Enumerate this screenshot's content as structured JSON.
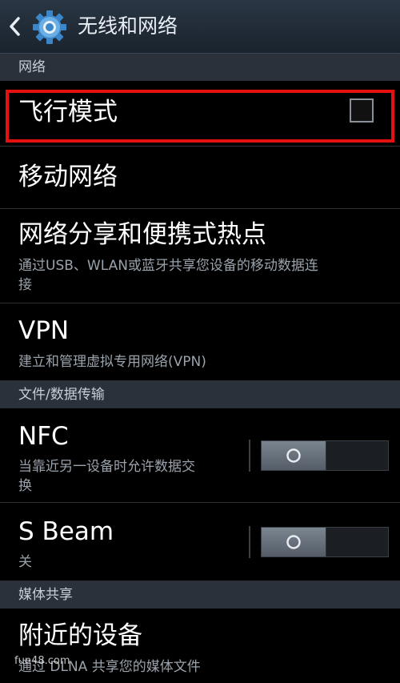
{
  "header": {
    "title": "无线和网络",
    "back_icon": "back-arrow-icon",
    "settings_icon": "gear-icon"
  },
  "sections": {
    "network": "网络",
    "file_transfer": "文件/数据传输",
    "media_sharing": "媒体共享"
  },
  "items": {
    "airplane_mode": {
      "label": "飞行模式",
      "checked": false
    },
    "mobile_network": {
      "label": "移动网络"
    },
    "tethering": {
      "label": "网络分享和便携式热点",
      "description_line1": "通过USB、WLAN或蓝牙共享您设备的移动数据连",
      "description_line2": "接"
    },
    "vpn": {
      "label": "VPN",
      "description": "建立和管理虚拟专用网络(VPN)"
    },
    "nfc": {
      "label": "NFC",
      "description_line1": "当靠近另一设备时允许数据交",
      "description_line2": "换",
      "enabled": false
    },
    "s_beam": {
      "label": "S Beam",
      "description": "关",
      "enabled": false
    },
    "nearby_devices": {
      "label": "附近的设备",
      "description": "通过 DLNA 共享您的媒体文件"
    }
  },
  "watermark": "fun48.com",
  "colors": {
    "highlight": "#e51010",
    "header_bg": "#2a3644",
    "section_bg": "#2a313b",
    "gear_blue": "#3a86c8"
  }
}
